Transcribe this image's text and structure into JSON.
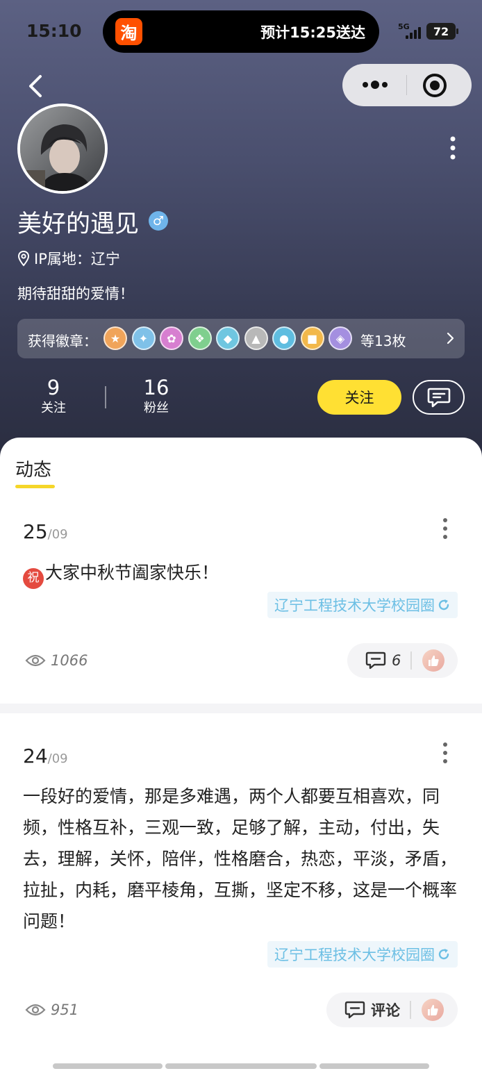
{
  "status_bar": {
    "time": "15:10",
    "island_app_icon": "淘",
    "island_text": "预计15:25送达",
    "network": "5G",
    "battery": "72"
  },
  "nav": {
    "back_icon": "chevron-left-icon",
    "capsule_more_icon": "ellipsis-icon",
    "capsule_close_icon": "target-icon"
  },
  "profile": {
    "nickname": "美好的遇见",
    "gender_symbol": "♂",
    "ip_location": "IP属地：辽宁",
    "bio": "期待甜甜的爱情！",
    "badges": {
      "label": "获得徽章：",
      "count_text": "等13枚",
      "medal_glyphs": [
        "★",
        "✦",
        "✿",
        "❖",
        "◆",
        "▲",
        "●",
        "■",
        "◈"
      ],
      "medal_colors": [
        "#f0a45a",
        "#7fc1e8",
        "#d77fd0",
        "#7fcf8e",
        "#6fc6e0",
        "#b8b8b8",
        "#5fbde0",
        "#f2b84b",
        "#a48fe0"
      ]
    },
    "stats": {
      "following_count": "9",
      "following_label": "关注",
      "fans_count": "16",
      "fans_label": "粉丝"
    },
    "follow_button": "关注"
  },
  "tabs": {
    "active": "动态"
  },
  "posts": [
    {
      "day": "25",
      "month": "/09",
      "badge": "祝",
      "text": "大家中秋节阖家快乐！",
      "campus": "辽宁工程技术大学校园圈",
      "views": "1066",
      "comment": "6"
    },
    {
      "day": "24",
      "month": "/09",
      "text": "一段好的爱情，那是多难遇，两个人都要互相喜欢，同频，性格互补，三观一致，足够了解，主动，付出，失去，理解，关怀，陪伴，性格磨合，热恋，平淡，矛盾，拉扯，内耗，磨平棱角，互撕，坚定不移，这是一个概率问题！",
      "campus": "辽宁工程技术大学校园圈",
      "views": "951",
      "comment": "评论"
    }
  ]
}
